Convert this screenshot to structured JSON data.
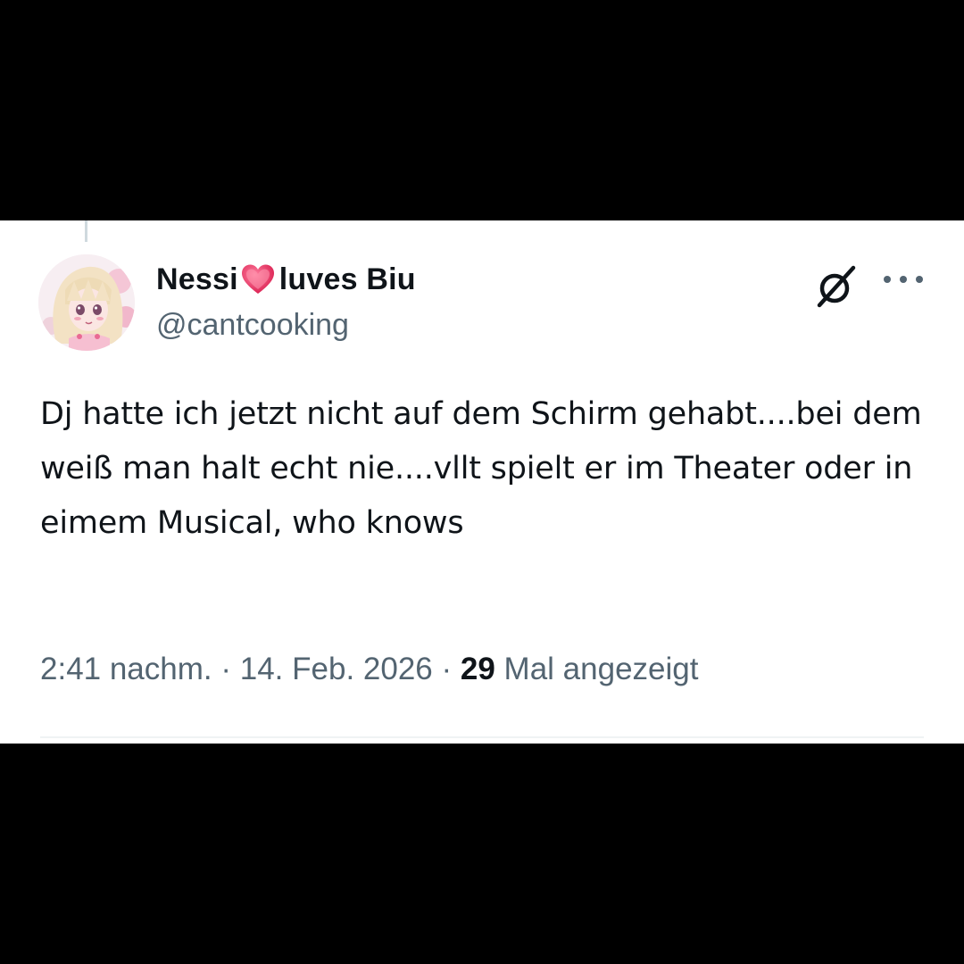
{
  "tweet": {
    "display_name_part1": "Nessi",
    "display_name_part2": "luves Biu",
    "name_emoji": "heart-icon",
    "handle": "@cantcooking",
    "text": "Dj hatte ich jetzt nicht auf dem Schirm gehabt....bei dem weiß man halt echt nie....vllt spielt er im Theater oder in eimem Musical, who knows",
    "time": "2:41 nachm.",
    "separator": "·",
    "date": "14. Feb. 2026",
    "views_count": "29",
    "views_label": "Mal angezeigt"
  },
  "icons": {
    "avatar": "avatar-anime-girl",
    "grok": "grok-icon",
    "more": "more-icon"
  },
  "colors": {
    "background": "#000000",
    "card": "#ffffff",
    "primary_text": "#0f1419",
    "secondary_text": "#536471",
    "heart": "#e0245e"
  }
}
